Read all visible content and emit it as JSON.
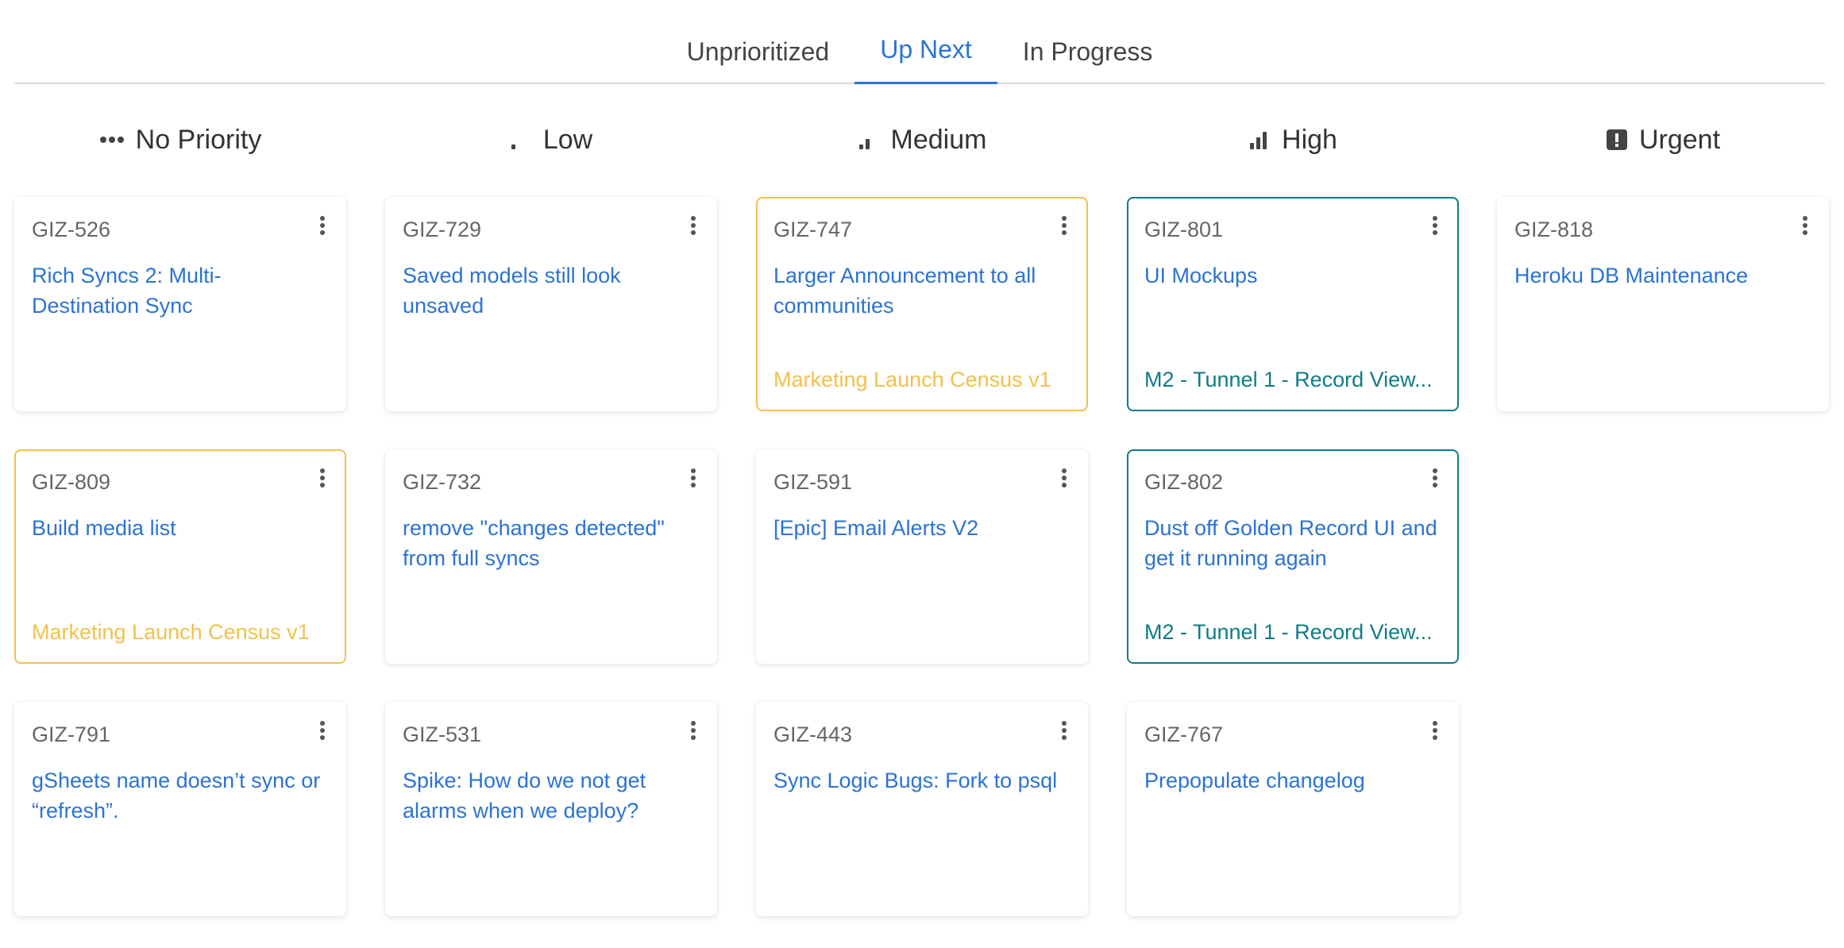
{
  "tabs": [
    "Unprioritized",
    "Up Next",
    "In Progress"
  ],
  "active_tab": "Up Next",
  "columns": [
    {
      "label": "No Priority",
      "icon": "no-priority-icon",
      "cards": [
        {
          "id": "GIZ-526",
          "title": "Rich Syncs 2: Multi-Destination Sync",
          "project": ""
        },
        {
          "id": "GIZ-809",
          "title": "Build media list",
          "project": "Marketing Launch Census v1"
        },
        {
          "id": "GIZ-791",
          "title": "gSheets name doesn’t sync or “refresh”.",
          "project": ""
        }
      ]
    },
    {
      "label": "Low",
      "icon": "low-priority-icon",
      "cards": [
        {
          "id": "GIZ-729",
          "title": "Saved models still look unsaved",
          "project": ""
        },
        {
          "id": "GIZ-732",
          "title": "remove \"changes detected\" from full syncs",
          "project": ""
        },
        {
          "id": "GIZ-531",
          "title": "Spike: How do we not get alarms when we deploy?",
          "project": ""
        }
      ]
    },
    {
      "label": "Medium",
      "icon": "medium-priority-icon",
      "cards": [
        {
          "id": "GIZ-747",
          "title": "Larger Announcement to all communities",
          "project": "Marketing Launch Census v1"
        },
        {
          "id": "GIZ-591",
          "title": "[Epic] Email Alerts V2",
          "project": ""
        },
        {
          "id": "GIZ-443",
          "title": "Sync Logic Bugs: Fork to psql",
          "project": ""
        }
      ]
    },
    {
      "label": "High",
      "icon": "high-priority-icon",
      "cards": [
        {
          "id": "GIZ-801",
          "title": "UI Mockups",
          "project": "M2 - Tunnel 1 - Record View..."
        },
        {
          "id": "GIZ-802",
          "title": "Dust off Golden Record UI and get it running again",
          "project": "M2 - Tunnel 1 - Record View..."
        },
        {
          "id": "GIZ-767",
          "title": "Prepopulate changelog",
          "project": ""
        }
      ]
    },
    {
      "label": "Urgent",
      "icon": "urgent-priority-icon",
      "cards": [
        {
          "id": "GIZ-818",
          "title": "Heroku DB Maintenance",
          "project": ""
        }
      ]
    }
  ],
  "colors": {
    "accent": "#2c73d2",
    "project_yellow": "#f2c14e",
    "project_teal": "#0e7c86"
  }
}
